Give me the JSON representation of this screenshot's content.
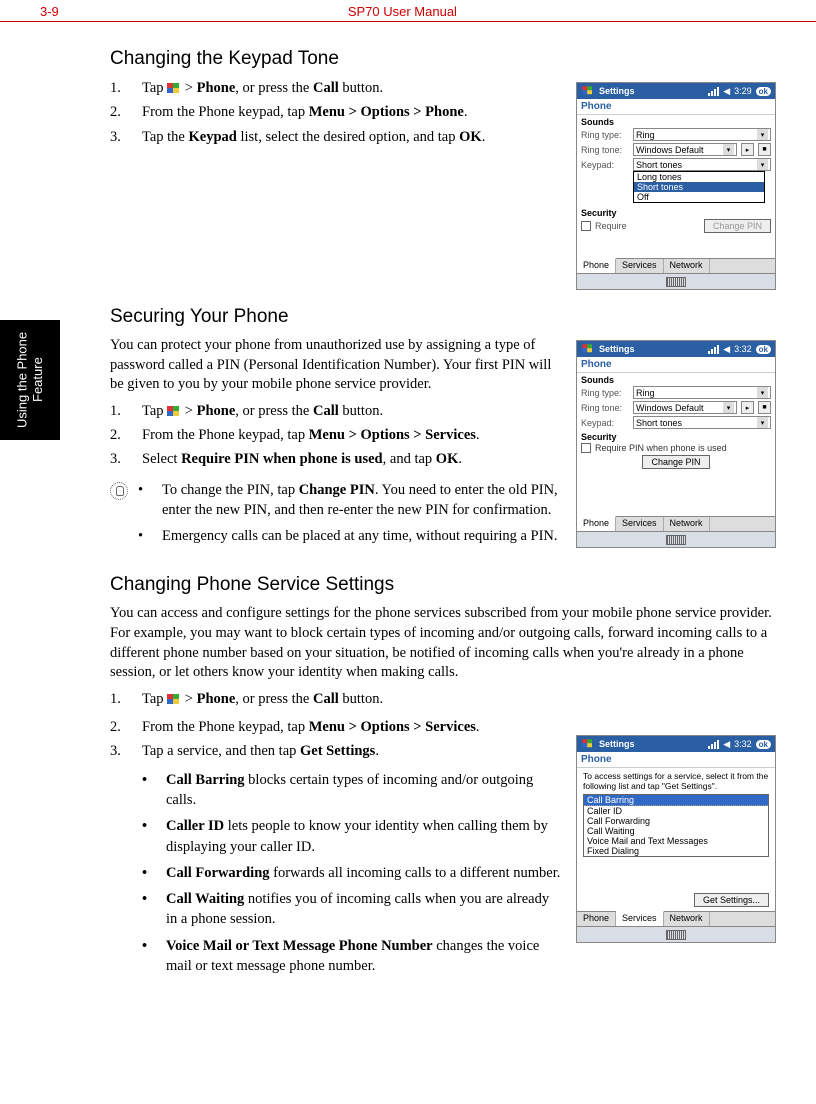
{
  "header": {
    "page_num": "3-9",
    "manual_title": "SP70 User Manual"
  },
  "side_tab": "Using the Phone Feature",
  "section1": {
    "title": "Changing the Keypad Tone",
    "steps": [
      {
        "num": "1.",
        "pre": "Tap ",
        "mid": " > ",
        "b1": "Phone",
        "post1": ", or press the ",
        "b2": "Call",
        "post2": " button."
      },
      {
        "num": "2.",
        "pre": "From the Phone keypad, tap ",
        "b1": "Menu > Options > Phone",
        "post1": "."
      },
      {
        "num": "3.",
        "pre": "Tap the ",
        "b1": "Keypad",
        "mid": " list, select the desired option, and tap ",
        "b2": "OK",
        "post1": "."
      }
    ]
  },
  "section2": {
    "title": "Securing Your Phone",
    "intro": "You can protect your phone from unauthorized use by assigning a type of password called a PIN (Personal Identification Number). Your first PIN will be given to you by your mobile phone service provider.",
    "steps": [
      {
        "num": "1.",
        "pre": "Tap ",
        "mid": " > ",
        "b1": "Phone",
        "post1": ", or press the ",
        "b2": "Call",
        "post2": " button."
      },
      {
        "num": "2.",
        "pre": "From the Phone keypad, tap ",
        "b1": "Menu > Options > Services",
        "post1": "."
      },
      {
        "num": "3.",
        "pre": "Select ",
        "b1": "Require PIN when phone is used",
        "mid": ", and tap ",
        "b2": "OK",
        "post1": "."
      }
    ],
    "tips": [
      {
        "pre": "To change the PIN, tap ",
        "b1": "Change PIN",
        "post1": ". You need to enter the old PIN, enter the new PIN, and then re-enter the new PIN for confirmation."
      },
      {
        "text": "Emergency calls can be placed at any time, without requiring a PIN."
      }
    ]
  },
  "section3": {
    "title": "Changing Phone Service Settings",
    "intro": "You can access and configure settings for the phone services subscribed from your mobile phone service provider. For example, you may want to block certain types of incoming and/or outgoing calls, forward incoming calls to a different phone number based on your situation, be notified of incoming calls when you're already in a phone session, or let others know your identity when making calls.",
    "steps": [
      {
        "num": "1.",
        "pre": "Tap ",
        "mid": " > ",
        "b1": "Phone",
        "post1": ", or press the ",
        "b2": "Call",
        "post2": " button."
      },
      {
        "num": "2.",
        "pre": "From the Phone keypad, tap ",
        "b1": "Menu > Options > Services",
        "post1": "."
      },
      {
        "num": "3.",
        "pre": "Tap a service, and then tap ",
        "b1": "Get Settings",
        "post1": "."
      }
    ],
    "services": [
      {
        "name": "Call Barring",
        "desc": "  blocks certain types of incoming and/or outgoing calls."
      },
      {
        "name": "Caller ID",
        "desc": "  lets people to know your identity when calling them by displaying your caller ID."
      },
      {
        "name": "Call Forwarding",
        "desc": "  forwards all incoming calls to a different number."
      },
      {
        "name": "Call Waiting",
        "desc": "  notifies you of incoming calls when you are already in a phone session."
      },
      {
        "name": "Voice Mail or Text Message Phone Number",
        "desc": "  changes the voice mail or text message phone number."
      }
    ]
  },
  "shot1": {
    "title": "Settings",
    "time": "3:29",
    "ok": "ok",
    "subtitle": "Phone",
    "sounds_label": "Sounds",
    "ring_type_lbl": "Ring type:",
    "ring_type_val": "Ring",
    "ring_tone_lbl": "Ring tone:",
    "ring_tone_val": "Windows Default",
    "keypad_lbl": "Keypad:",
    "keypad_val": "Short tones",
    "dropdown": [
      "Long tones",
      "Short tones",
      "Off"
    ],
    "dropdown_sel": "Short tones",
    "security_label": "Security",
    "require_text": "Require",
    "change_pin": "Change PIN",
    "tabs": [
      "Phone",
      "Services",
      "Network"
    ],
    "active_tab": "Phone"
  },
  "shot2": {
    "title": "Settings",
    "time": "3:32",
    "ok": "ok",
    "subtitle": "Phone",
    "sounds_label": "Sounds",
    "ring_type_lbl": "Ring type:",
    "ring_type_val": "Ring",
    "ring_tone_lbl": "Ring tone:",
    "ring_tone_val": "Windows Default",
    "keypad_lbl": "Keypad:",
    "keypad_val": "Short tones",
    "security_label": "Security",
    "require_text": "Require PIN when phone is used",
    "change_pin": "Change PIN",
    "tabs": [
      "Phone",
      "Services",
      "Network"
    ],
    "active_tab": "Phone"
  },
  "shot3": {
    "title": "Settings",
    "time": "3:32",
    "ok": "ok",
    "subtitle": "Phone",
    "intro_text": "To access settings for a service, select it from the following list and tap \"Get Settings\".",
    "list": [
      "Call Barring",
      "Caller ID",
      "Call Forwarding",
      "Call Waiting",
      "Voice Mail and Text Messages",
      "Fixed Dialing"
    ],
    "selected": "Call Barring",
    "get_settings": "Get Settings...",
    "tabs": [
      "Phone",
      "Services",
      "Network"
    ],
    "active_tab": "Services"
  }
}
